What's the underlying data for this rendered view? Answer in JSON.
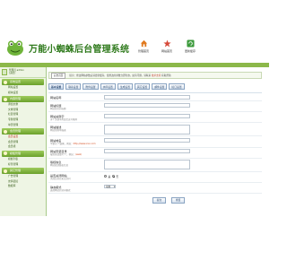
{
  "header": {
    "title": "万能小蜘蛛后台管理系统",
    "nav": [
      {
        "label": "管理首页",
        "icon": "home-icon",
        "color": "#e07a1f"
      },
      {
        "label": "网站首页",
        "icon": "star-icon",
        "color": "#d64a3a"
      },
      {
        "label": "更新缓存",
        "icon": "refresh-icon",
        "color": "#3c9a3c"
      }
    ]
  },
  "sidebar": {
    "user": {
      "line1": "管理员 admin",
      "line2": "[退出]"
    },
    "sections": [
      {
        "title": "系统设置",
        "items": [
          {
            "label": "网站设置",
            "active": false
          },
          {
            "label": "模块设置",
            "active": false
          }
        ]
      },
      {
        "title": "内容管理",
        "items": [
          {
            "label": "添加文章",
            "active": false
          },
          {
            "label": "文章管理",
            "active": false
          },
          {
            "label": "栏目管理",
            "active": false
          },
          {
            "label": "专题管理",
            "active": false
          },
          {
            "label": "单页管理",
            "active": false
          }
        ]
      },
      {
        "title": "会员管理",
        "items": [
          {
            "label": "会员设置",
            "active": true
          },
          {
            "label": "会员管理",
            "active": false
          },
          {
            "label": "会员组",
            "active": false
          }
        ]
      },
      {
        "title": "模板管理",
        "items": [
          {
            "label": "模板列表",
            "active": false
          },
          {
            "label": "标签管理",
            "active": false
          }
        ]
      },
      {
        "title": "其它管理",
        "items": [
          {
            "label": "广告管理",
            "active": false
          },
          {
            "label": "友情链接",
            "active": false
          },
          {
            "label": "数据库",
            "active": false
          }
        ]
      }
    ]
  },
  "main": {
    "breadcrumb": {
      "button": "后台首页",
      "text_pre": "提示：修改网站参数后请更新缓存，使修改的参数立即生效。如有问题，请联系 ",
      "text_red": "技术支持",
      "text_post": " 获取帮助"
    },
    "tabs": [
      {
        "label": "基本设置",
        "active": true
      },
      {
        "label": "联系设置",
        "active": false
      },
      {
        "label": "附件设置",
        "active": false
      },
      {
        "label": "水印设置",
        "active": false
      },
      {
        "label": "生成设置",
        "active": false
      },
      {
        "label": "其它设置",
        "active": false
      },
      {
        "label": "邮件设置",
        "active": false
      },
      {
        "label": "接口设置",
        "active": false
      }
    ],
    "form": {
      "rows": [
        {
          "label": "网站名称",
          "hint": "",
          "hint_red": "",
          "control": "input",
          "value": ""
        },
        {
          "label": "网站标题",
          "hint": "网站首页的标题",
          "hint_red": "",
          "control": "input",
          "value": ""
        },
        {
          "label": "网站关键字",
          "hint": "多个关键字用英文逗号隔开",
          "hint_red": "",
          "control": "input",
          "value": ""
        },
        {
          "label": "网站描述",
          "hint": "网站的简单描述",
          "hint_red": "",
          "control": "textarea",
          "value": ""
        },
        {
          "label": "网站域名",
          "hint": "不要以\"/\"结尾，例如：",
          "hint_red": "http://www.xxx.com",
          "control": "input",
          "value": ""
        },
        {
          "label": "网站安装目录",
          "hint": "根目录请填写\"/\"，例如：",
          "hint_red": "/web/",
          "control": "input",
          "value": ""
        },
        {
          "label": "版权信息",
          "hint": "网站底部版权信息",
          "hint_red": "",
          "control": "textarea",
          "value": ""
        },
        {
          "label": "是否关闭网站",
          "hint": "关闭后前台无法访问",
          "hint_red": "",
          "control": "radio",
          "options": [
            "是",
            "否"
          ],
          "selected": 1
        },
        {
          "label": "静态模式",
          "hint": "选择网站的访问模式",
          "hint_red": "",
          "control": "select",
          "value": "动态"
        }
      ]
    },
    "buttons": {
      "submit": "提交",
      "reset": "重置"
    }
  },
  "colors": {
    "brand_green": "#8cb84a",
    "title_green": "#2f7a1c",
    "tab_blue": "#2c4b72"
  }
}
